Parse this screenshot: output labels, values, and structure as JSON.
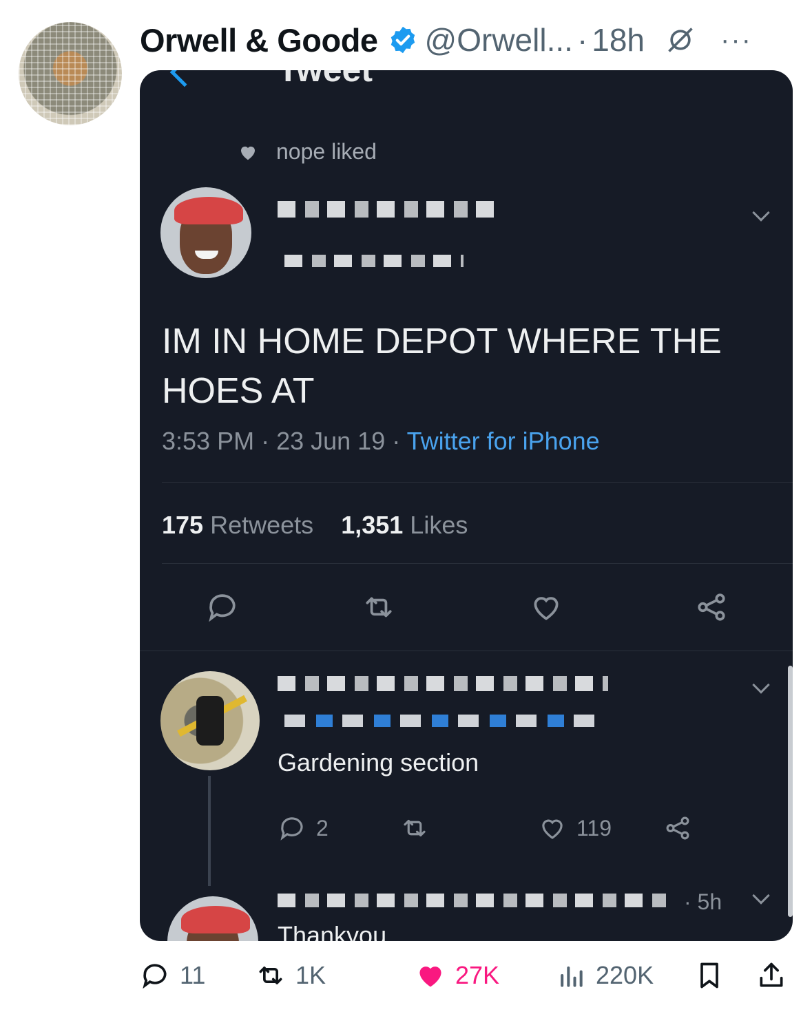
{
  "post": {
    "display_name": "Orwell & Goode",
    "handle": "@Orwell...",
    "separator": "·",
    "time": "18h",
    "more": "···"
  },
  "screenshot": {
    "title": "Tweet",
    "liked_by": "nope liked",
    "tweet_text": "IM IN HOME DEPOT WHERE THE HOES AT",
    "time": "3:53 PM",
    "date": "23 Jun 19",
    "source": "Twitter for iPhone",
    "sep1": " · ",
    "sep2": " · ",
    "retweets_count": "175",
    "retweets_label": "Retweets",
    "likes_count": "1,351",
    "likes_label": "Likes",
    "reply": {
      "text": "Gardening section",
      "replies": "2",
      "likes": "119"
    },
    "second_reply": {
      "time": "· 5h",
      "text": "Thankyou"
    }
  },
  "actions": {
    "replies": "11",
    "reposts": "1K",
    "likes": "27K",
    "views": "220K"
  },
  "colors": {
    "like_pink": "#f91880",
    "verified_blue": "#1d9bf0",
    "link_blue": "#4aa3ee",
    "screenshot_bg": "#161b26"
  }
}
